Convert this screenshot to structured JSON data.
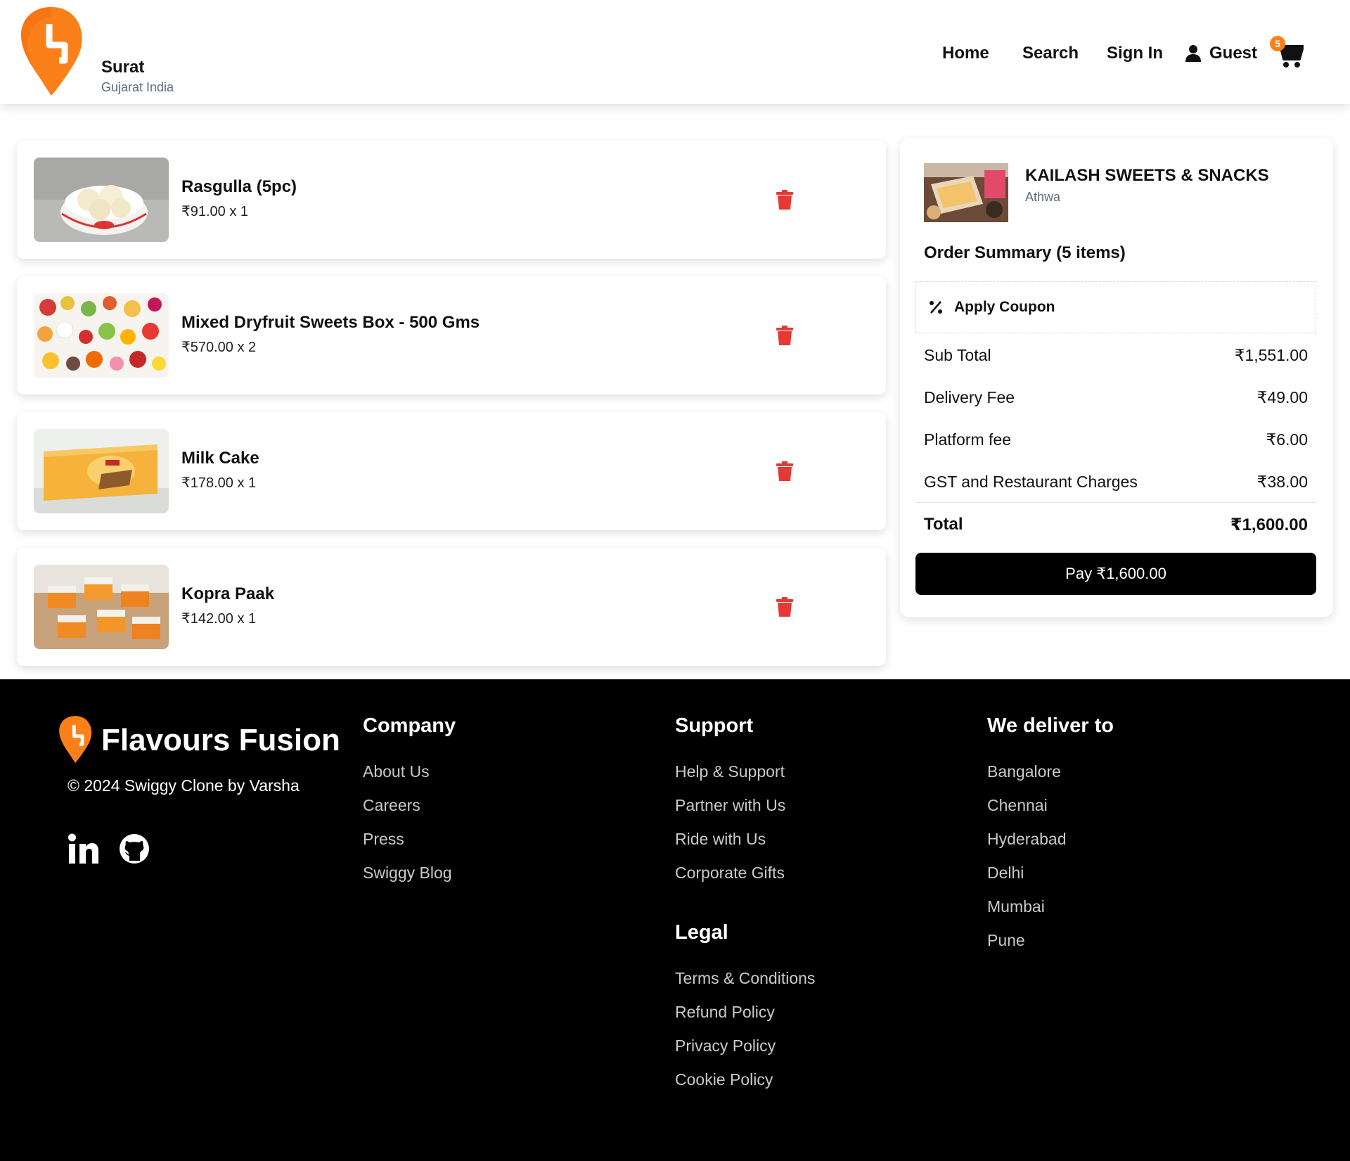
{
  "header": {
    "logo_icon": "swiggy-logo-icon",
    "location_city": "Surat",
    "location_state": "Gujarat India",
    "nav": {
      "home": "Home",
      "search": "Search",
      "sign_in": "Sign In",
      "user": "Guest"
    },
    "cart_count": "5",
    "brand_color": "#fc8019"
  },
  "cart": {
    "items": [
      {
        "name": "Rasgulla (5pc)",
        "price": "₹91.00 x 1",
        "image": "rasgulla-photo"
      },
      {
        "name": "Mixed Dryfruit Sweets Box - 500 Gms",
        "price": "₹570.00 x 2",
        "image": "mixed-sweets-photo"
      },
      {
        "name": "Milk Cake",
        "price": "₹178.00 x 1",
        "image": "milk-cake-box-photo"
      },
      {
        "name": "Kopra Paak",
        "price": "₹142.00 x 1",
        "image": "kopra-paak-photo"
      }
    ],
    "delete_icon": "trash-icon",
    "delete_color": "#e53935"
  },
  "summary": {
    "restaurant_name": "KAILASH SWEETS & SNACKS",
    "restaurant_area": "Athwa",
    "title": "Order Summary (5 items)",
    "coupon_label": "Apply Coupon",
    "rows": [
      {
        "label": "Sub Total",
        "value": "₹1,551.00"
      },
      {
        "label": "Delivery Fee",
        "value": "₹49.00"
      },
      {
        "label": "Platform fee",
        "value": "₹6.00"
      },
      {
        "label": "GST and Restaurant Charges",
        "value": "₹38.00"
      }
    ],
    "total_label": "Total",
    "total_value": "₹1,600.00",
    "pay_label": "Pay ₹1,600.00"
  },
  "footer": {
    "brand": "Flavours Fusion",
    "copyright": "© 2024 Swiggy Clone by Varsha",
    "social": [
      "linkedin-icon",
      "github-icon"
    ],
    "company": {
      "title": "Company",
      "links": [
        "About Us",
        "Careers",
        "Press",
        "Swiggy Blog"
      ]
    },
    "support": {
      "title": "Support",
      "links": [
        "Help & Support",
        "Partner with Us",
        "Ride with Us",
        "Corporate Gifts"
      ]
    },
    "legal": {
      "title": "Legal",
      "links": [
        "Terms & Conditions",
        "Refund Policy",
        "Privacy Policy",
        "Cookie Policy"
      ]
    },
    "deliver": {
      "title": "We deliver to",
      "links": [
        "Bangalore",
        "Chennai",
        "Hyderabad",
        "Delhi",
        "Mumbai",
        "Pune"
      ]
    }
  }
}
